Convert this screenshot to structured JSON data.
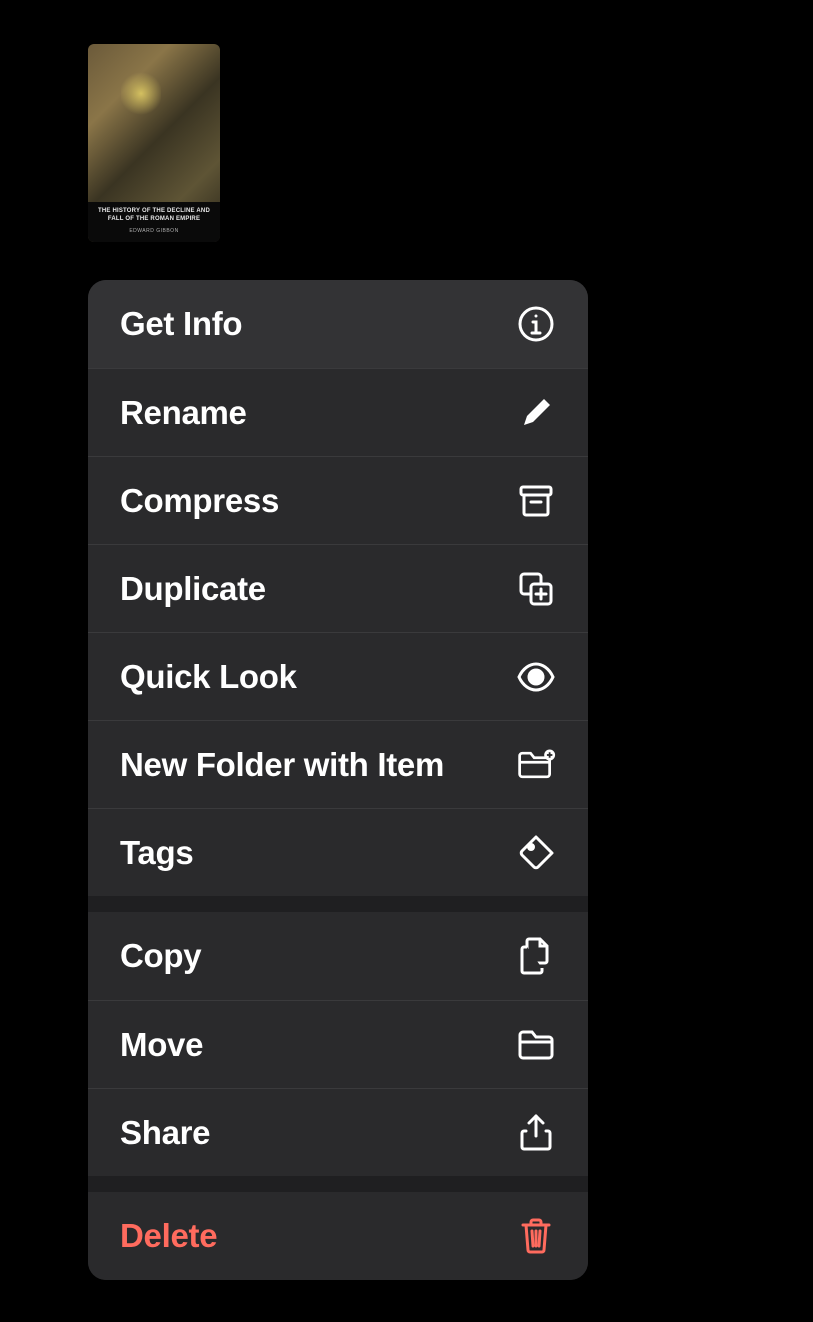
{
  "file": {
    "cover_title": "THE HISTORY OF\nTHE DECLINE AND FALL\nOF THE ROMAN EMPIRE",
    "cover_author": "EDWARD GIBBON"
  },
  "menu": {
    "groups": [
      [
        {
          "id": "get-info",
          "label": "Get Info",
          "icon": "info-circle-icon"
        },
        {
          "id": "rename",
          "label": "Rename",
          "icon": "pencil-icon"
        },
        {
          "id": "compress",
          "label": "Compress",
          "icon": "archivebox-icon"
        },
        {
          "id": "duplicate",
          "label": "Duplicate",
          "icon": "duplicate-icon"
        },
        {
          "id": "quick-look",
          "label": "Quick Look",
          "icon": "eye-icon"
        },
        {
          "id": "new-folder-with-item",
          "label": "New Folder with Item",
          "icon": "folder-plus-icon"
        },
        {
          "id": "tags",
          "label": "Tags",
          "icon": "tag-icon"
        }
      ],
      [
        {
          "id": "copy",
          "label": "Copy",
          "icon": "copy-doc-icon"
        },
        {
          "id": "move",
          "label": "Move",
          "icon": "folder-icon"
        },
        {
          "id": "share",
          "label": "Share",
          "icon": "share-icon"
        }
      ],
      [
        {
          "id": "delete",
          "label": "Delete",
          "icon": "trash-icon",
          "destructive": true
        }
      ]
    ]
  }
}
